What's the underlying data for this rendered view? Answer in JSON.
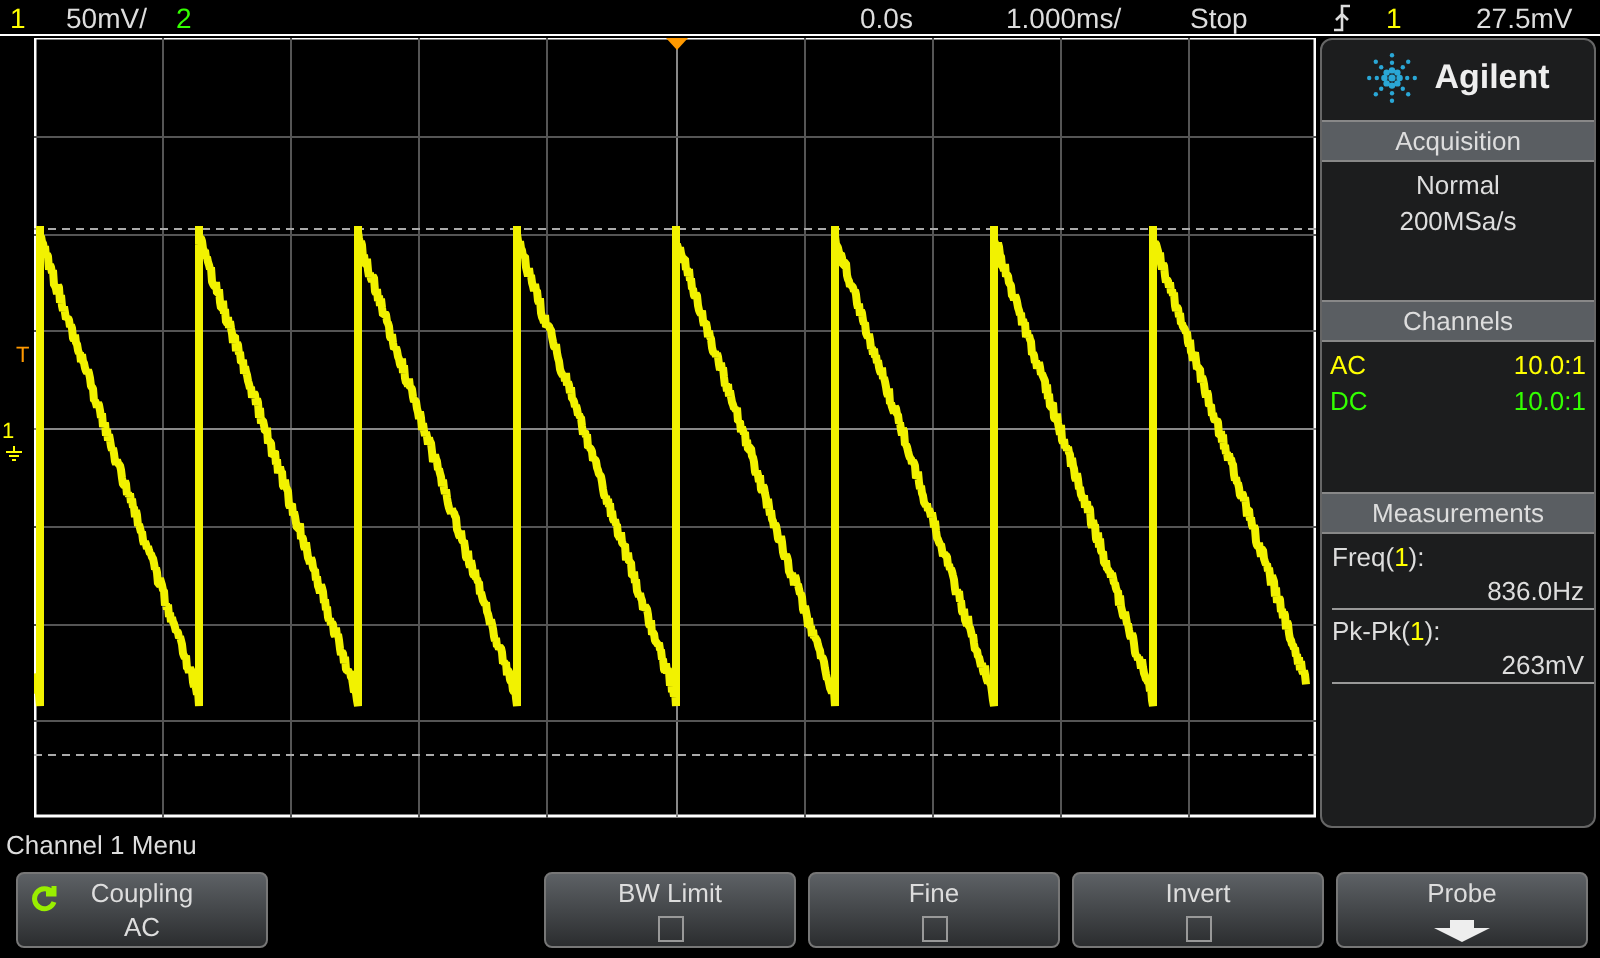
{
  "top_bar": {
    "channel_1": "1",
    "vertical_scale": "50mV/",
    "channel_2": "2",
    "delay": "0.0s",
    "timebase": "1.000ms/",
    "run_state": "Stop",
    "trigger_source": "1",
    "trigger_level": "27.5mV"
  },
  "display": {
    "trigger_marker": "T",
    "channel_marker": "1"
  },
  "side_panel": {
    "logo": "Agilent",
    "acquisition": {
      "title": "Acquisition",
      "lines": [
        "Normal",
        "200MSa/s"
      ]
    },
    "channels": {
      "title": "Channels",
      "rows": [
        {
          "coupling": "AC",
          "probe": "10.0:1",
          "color": "#ffff00"
        },
        {
          "coupling": "DC",
          "probe": "10.0:1",
          "color": "#33ff00"
        }
      ]
    },
    "measurements": {
      "title": "Measurements",
      "items": [
        {
          "name": "Freq(",
          "source": "1",
          "close": "):",
          "value": "836.0Hz"
        },
        {
          "name": "Pk-Pk(",
          "source": "1",
          "close": "):",
          "value": "263mV"
        }
      ]
    }
  },
  "menu": {
    "title": "Channel 1 Menu",
    "softkeys": [
      {
        "kind": "value",
        "label": "Coupling",
        "value": "AC"
      },
      {
        "kind": "blank"
      },
      {
        "kind": "checkbox",
        "label": "BW Limit",
        "checked": false
      },
      {
        "kind": "checkbox",
        "label": "Fine",
        "checked": false
      },
      {
        "kind": "checkbox",
        "label": "Invert",
        "checked": false
      },
      {
        "kind": "submenu",
        "label": "Probe"
      }
    ]
  }
}
